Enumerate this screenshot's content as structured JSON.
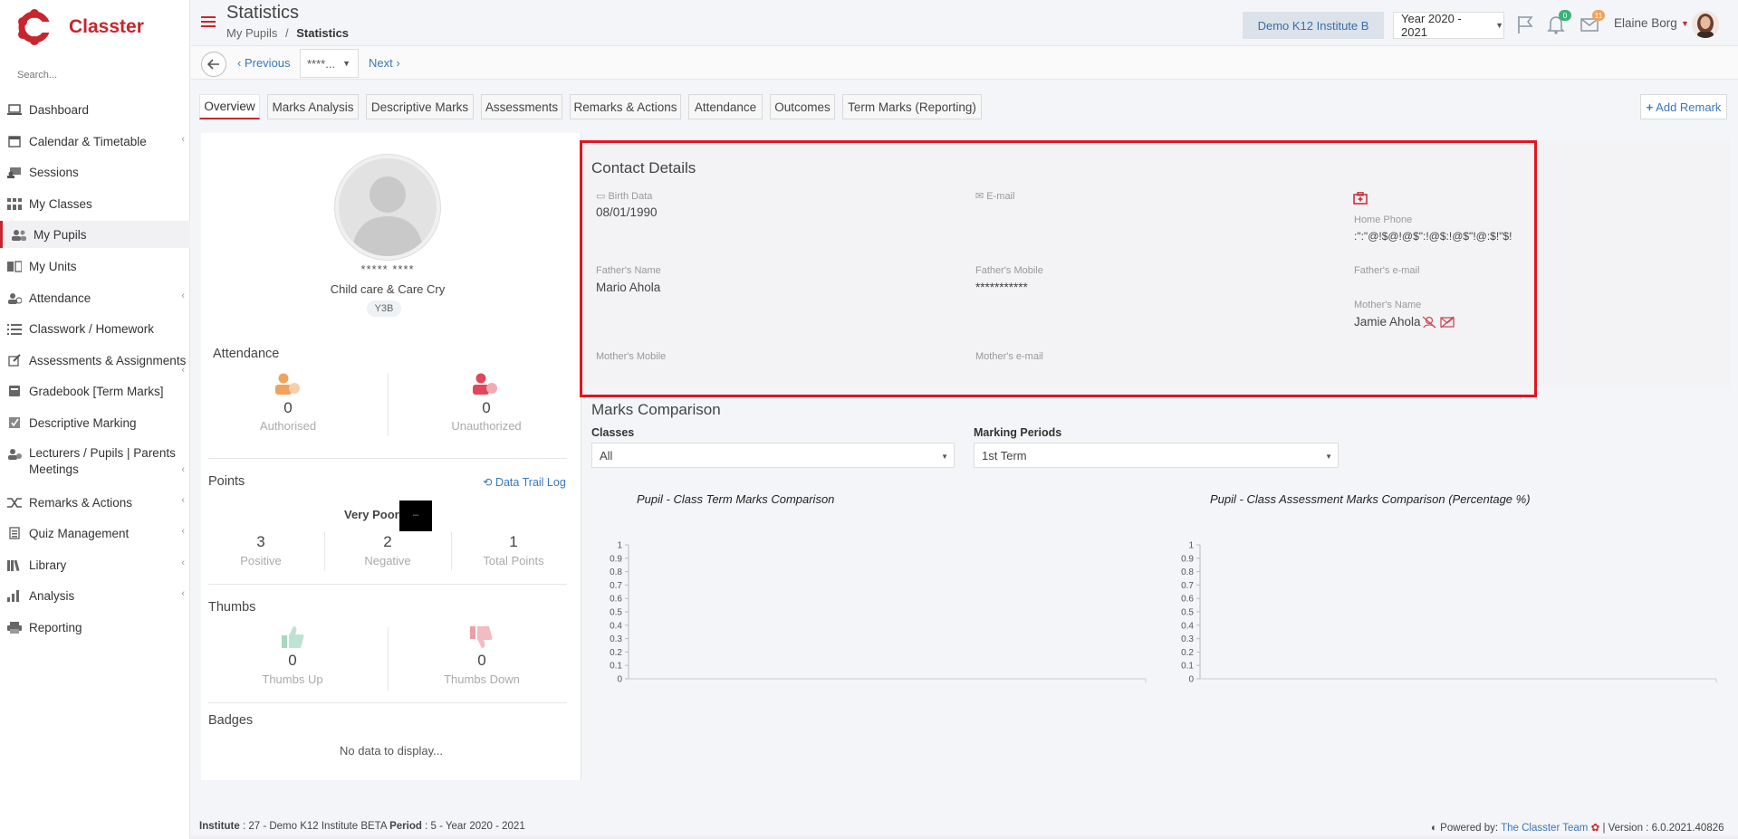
{
  "app": {
    "name": "Classter"
  },
  "sidebar": {
    "search_placeholder": "Search...",
    "items": [
      {
        "label": "Dashboard",
        "icon": "laptop-icon"
      },
      {
        "label": "Calendar & Timetable",
        "icon": "calendar-icon"
      },
      {
        "label": "Sessions",
        "icon": "sessions-icon"
      },
      {
        "label": "My Classes",
        "icon": "classes-icon"
      },
      {
        "label": "My Pupils",
        "icon": "pupils-icon"
      },
      {
        "label": "My Units",
        "icon": "book-icon"
      },
      {
        "label": "Attendance",
        "icon": "attendance-icon"
      },
      {
        "label": "Classwork / Homework",
        "icon": "list-icon"
      },
      {
        "label": "Assessments & Assignments",
        "icon": "edit-icon"
      },
      {
        "label": "Gradebook [Term Marks]",
        "icon": "gradebook-icon"
      },
      {
        "label": "Descriptive Marking",
        "icon": "descriptive-icon"
      },
      {
        "label": "Lecturers / Pupils | Parents Meetings",
        "icon": "meetings-icon"
      },
      {
        "label": "Remarks & Actions",
        "icon": "shuffle-icon"
      },
      {
        "label": "Quiz Management",
        "icon": "quiz-icon"
      },
      {
        "label": "Library",
        "icon": "library-icon"
      },
      {
        "label": "Analysis",
        "icon": "analysis-icon"
      },
      {
        "label": "Reporting",
        "icon": "printer-icon"
      }
    ]
  },
  "header": {
    "title": "Statistics",
    "breadcrumb_parent": "My Pupils",
    "breadcrumb_sep": "/",
    "breadcrumb_current": "Statistics",
    "institute": "Demo K12 Institute B",
    "year": "Year 2020 - 2021",
    "notifications_count": "0",
    "messages_count": "11",
    "user_name": "Elaine Borg"
  },
  "navbar": {
    "previous": "Previous",
    "pupil_selected": "****...",
    "next": "Next"
  },
  "tabs": [
    "Overview",
    "Marks Analysis",
    "Descriptive Marks",
    "Assessments",
    "Remarks & Actions",
    "Attendance",
    "Outcomes",
    "Term Marks (Reporting)"
  ],
  "add_remark": "Add Remark",
  "profile": {
    "name": "***** ****",
    "course": "Child care & Care Cry",
    "class": "Y3B"
  },
  "attendance": {
    "title": "Attendance",
    "authorised": {
      "value": "0",
      "label": "Authorised"
    },
    "unauthorized": {
      "value": "0",
      "label": "Unauthorized"
    }
  },
  "points": {
    "title": "Points",
    "data_trail": "Data Trail Log",
    "rating": "Very Poor",
    "positive": {
      "value": "3",
      "label": "Positive"
    },
    "negative": {
      "value": "2",
      "label": "Negative"
    },
    "total": {
      "value": "1",
      "label": "Total Points"
    }
  },
  "thumbs": {
    "title": "Thumbs",
    "up": {
      "value": "0",
      "label": "Thumbs Up"
    },
    "down": {
      "value": "0",
      "label": "Thumbs Down"
    }
  },
  "badges": {
    "title": "Badges",
    "empty": "No data to display..."
  },
  "contact": {
    "title": "Contact Details",
    "birth_label": "Birth Data",
    "birth_value": "08/01/1990",
    "email_label": "E-mail",
    "home_phone_label": "Home Phone",
    "home_phone_value": ":\":\"@!$@!@$\":!@$:!@$\"!@:$!\"$!",
    "father_name_label": "Father's Name",
    "father_name_value": "Mario Ahola",
    "father_mobile_label": "Father's Mobile",
    "father_mobile_value": "***********",
    "father_email_label": "Father's e-mail",
    "mother_name_label": "Mother's Name",
    "mother_name_value": "Jamie Ahola",
    "mother_mobile_label": "Mother's Mobile",
    "mother_email_label": "Mother's e-mail"
  },
  "marks": {
    "title": "Marks Comparison",
    "classes_label": "Classes",
    "classes_value": "All",
    "periods_label": "Marking Periods",
    "periods_value": "1st Term",
    "chart1_title": "Pupil - Class Term Marks Comparison",
    "chart2_title": "Pupil - Class Assessment Marks Comparison (Percentage %)"
  },
  "chart_data": [
    {
      "type": "bar",
      "title": "Pupil - Class Term Marks Comparison",
      "categories": [],
      "series": [],
      "ylim": [
        0,
        1
      ],
      "yticks": [
        "0",
        "0.1",
        "0.2",
        "0.3",
        "0.4",
        "0.5",
        "0.6",
        "0.7",
        "0.8",
        "0.9",
        "1"
      ]
    },
    {
      "type": "bar",
      "title": "Pupil - Class Assessment Marks Comparison (Percentage %)",
      "categories": [],
      "series": [],
      "ylim": [
        0,
        1
      ],
      "yticks": [
        "0",
        "0.1",
        "0.2",
        "0.3",
        "0.4",
        "0.5",
        "0.6",
        "0.7",
        "0.8",
        "0.9",
        "1"
      ]
    }
  ],
  "footer": {
    "institute_label": "Institute",
    "institute_value": ": 27 - Demo K12 Institute BETA",
    "period_label": "Period",
    "period_value": ": 5 - Year 2020 - 2021",
    "powered_by": "Powered by:",
    "team": "The Classter Team",
    "version": "| Version : 6.0.2021.40826"
  },
  "colors": {
    "brand": "#c8252c",
    "link": "#3a78b8",
    "highlight": "#e3141f"
  }
}
